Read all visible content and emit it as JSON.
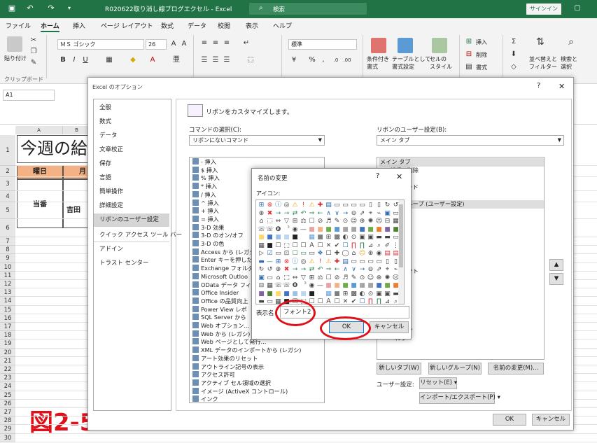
{
  "window": {
    "title": "R020622取り消し線プログエクセル  -  Excel",
    "search_placeholder": "検索",
    "signin_label": "サインイン"
  },
  "menu": [
    "ファイル",
    "ホーム",
    "挿入",
    "ページ レイアウト",
    "数式",
    "データ",
    "校閲",
    "表示",
    "ヘルプ"
  ],
  "ribbon": {
    "paste_label": "貼り付け",
    "clipboard_label": "クリップボード",
    "font_name": "ＭＳ ゴシック",
    "font_size": "26",
    "number_format": "標準",
    "insert_label": "挿入",
    "delete_label": "削除",
    "format_label": "書式",
    "conditional_label": "条件付き\n書式",
    "table_label": "テーブルとして\n書式設定",
    "cellstyle_label": "セルの\nスタイル",
    "sortfilter_label": "並べ替えと\nフィルター",
    "find_label": "検索と\n選択"
  },
  "formula": {
    "namebox": "A1"
  },
  "sheet": {
    "title_partial": "今週の給",
    "hdr_youbi": "曜日",
    "hdr_tsuki": "月",
    "toban": "当番",
    "yoshida": "吉田",
    "rows": [
      "1",
      "2",
      "3",
      "4",
      "5",
      "6",
      "7",
      "8",
      "9",
      "10",
      "11",
      "12",
      "13",
      "14",
      "15",
      "16",
      "17",
      "18",
      "19",
      "20",
      "21",
      "22",
      "23",
      "24",
      "25",
      "26",
      "27",
      "28",
      "29",
      "30"
    ],
    "cols": [
      "A",
      "B"
    ],
    "figure_label": "図2-5"
  },
  "options_dialog": {
    "title": "Excel のオプション",
    "help": "?",
    "close": "✕",
    "nav": [
      "全般",
      "数式",
      "データ",
      "文章校正",
      "保存",
      "言語",
      "簡単操作",
      "詳細設定",
      "リボンのユーザー設定",
      "クイック アクセス ツール バー",
      "アドイン",
      "トラスト センター"
    ],
    "heading": "リボンをカスタマイズします。",
    "choose_label": "コマンドの選択(C):",
    "choose_value": "リボンにないコマンド",
    "customize_label": "リボンのユーザー設定(B):",
    "customize_value": "メイン タブ",
    "commands": [
      "- 挿入",
      "$ 挿入",
      "% 挿入",
      "* 挿入",
      "/ 挿入",
      "^ 挿入",
      "+ 挿入",
      "= 挿入",
      "3-D 効果",
      "3-D のオン/オフ",
      "3-D の色",
      "Access から (レガシ",
      "Enter キーを押した",
      "Exchange フォルダ",
      "Microsoft Outloo",
      "OData データ フィ",
      "Office Insider",
      "Office の品質向上",
      "Power View レポ",
      "SQL Server から",
      "Web オプション...",
      "Web から (レガシ)",
      "Web ページとして発行...",
      "XML データのインポートから (レガシ)",
      "アート効果のリセット",
      "アウトライン記号の表示",
      "アクセス許可",
      "アクティブ セル領域の選択",
      "イメージ (ActiveX コントロール)",
      "インク"
    ],
    "tree": [
      "メイン タブ",
      "新規の削除",
      "",
      "ップボード",
      "ント",
      "しいグループ (ユーザー設定)",
      "置",
      "タイル",
      "ル",
      "集",
      "デア",
      "",
      "",
      "レイアウト",
      "",
      "",
      "",
      "",
      "",
      "",
      "アドイン",
      "ヘルプ"
    ],
    "new_tab_btn": "新しいタブ(W)",
    "new_group_btn": "新しいグループ(N)",
    "rename_btn": "名前の変更(M)...",
    "user_settings_label": "ユーザー設定:",
    "reset_btn": "リセット(E)",
    "import_btn": "インポート/エクスポート(P)",
    "ok": "OK",
    "cancel": "キャンセル"
  },
  "rename_dialog": {
    "title": "名前の変更",
    "help": "?",
    "close": "✕",
    "icon_label": "アイコン:",
    "display_label": "表示名",
    "display_value": "フォント2",
    "ok": "OK",
    "cancel": "キャンセル"
  },
  "colors": {
    "excel_green": "#217346",
    "highlight": "#e0101a"
  }
}
